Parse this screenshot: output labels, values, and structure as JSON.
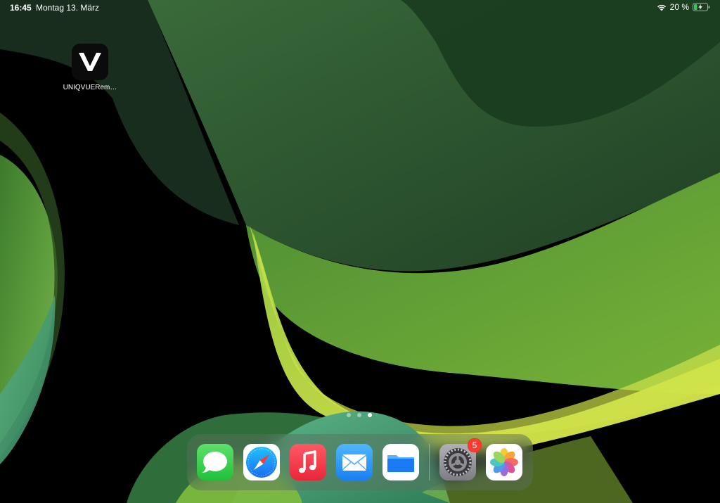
{
  "status_bar": {
    "time": "16:45",
    "date": "Montag 13. März",
    "battery_percent": "20 %",
    "icons": [
      "wifi-icon",
      "battery-charging-icon"
    ]
  },
  "home_screen": {
    "apps": [
      {
        "label": "UNIQVUERem…",
        "icon": "uniqvue-v-logo-icon"
      }
    ],
    "pages": 3,
    "current_page": 3
  },
  "dock": {
    "apps": [
      {
        "name": "messages",
        "icon": "messages-icon"
      },
      {
        "name": "safari",
        "icon": "safari-compass-icon"
      },
      {
        "name": "music",
        "icon": "music-note-icon"
      },
      {
        "name": "mail",
        "icon": "mail-envelope-icon"
      },
      {
        "name": "files",
        "icon": "files-folder-icon"
      },
      {
        "name": "settings",
        "icon": "settings-gear-icon",
        "badge": "5"
      },
      {
        "name": "photos",
        "icon": "photos-flower-icon"
      }
    ]
  },
  "colors": {
    "badge": "#ff3b30",
    "messages": "#34c759",
    "music": "#fc3c44",
    "mail": "#1a8cff",
    "files": "#1a7cf5"
  }
}
